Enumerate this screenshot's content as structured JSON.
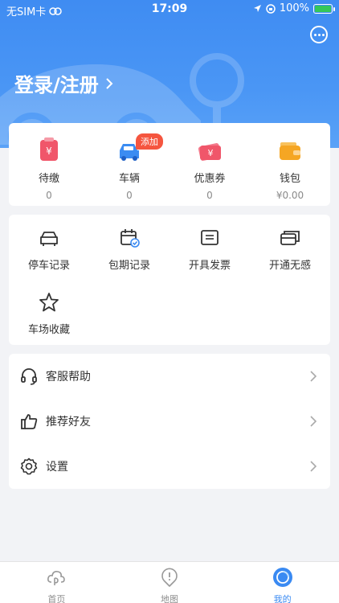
{
  "status_bar": {
    "carrier": "无SIM卡",
    "time": "17:09",
    "battery": "100%"
  },
  "header": {
    "login_label": "登录/注册",
    "message_icon": "chat-bubble-icon"
  },
  "summary": [
    {
      "label": "待缴",
      "value": "0",
      "icon": "bill-icon",
      "color": "#f0566a"
    },
    {
      "label": "车辆",
      "value": "0",
      "icon": "car-pin-icon",
      "color": "#3b8cf2",
      "badge": "添加"
    },
    {
      "label": "优惠券",
      "value": "0",
      "icon": "coupon-icon",
      "color": "#f47a8c"
    },
    {
      "label": "钱包",
      "value": "¥0.00",
      "icon": "wallet-icon",
      "color": "#f5a623"
    }
  ],
  "services": [
    {
      "label": "停车记录",
      "icon": "car-outline-icon"
    },
    {
      "label": "包期记录",
      "icon": "calendar-check-icon"
    },
    {
      "label": "开具发票",
      "icon": "invoice-icon"
    },
    {
      "label": "开通无感",
      "icon": "card-icon"
    },
    {
      "label": "车场收藏",
      "icon": "star-icon"
    }
  ],
  "menu": [
    {
      "label": "客服帮助",
      "icon": "headset-icon"
    },
    {
      "label": "推荐好友",
      "icon": "thumbs-up-icon"
    },
    {
      "label": "设置",
      "icon": "gear-icon"
    }
  ],
  "tabs": [
    {
      "label": "首页",
      "icon": "home-cloud-icon",
      "active": false
    },
    {
      "label": "地图",
      "icon": "map-pin-icon",
      "active": false
    },
    {
      "label": "我的",
      "icon": "profile-circle-icon",
      "active": true
    }
  ]
}
